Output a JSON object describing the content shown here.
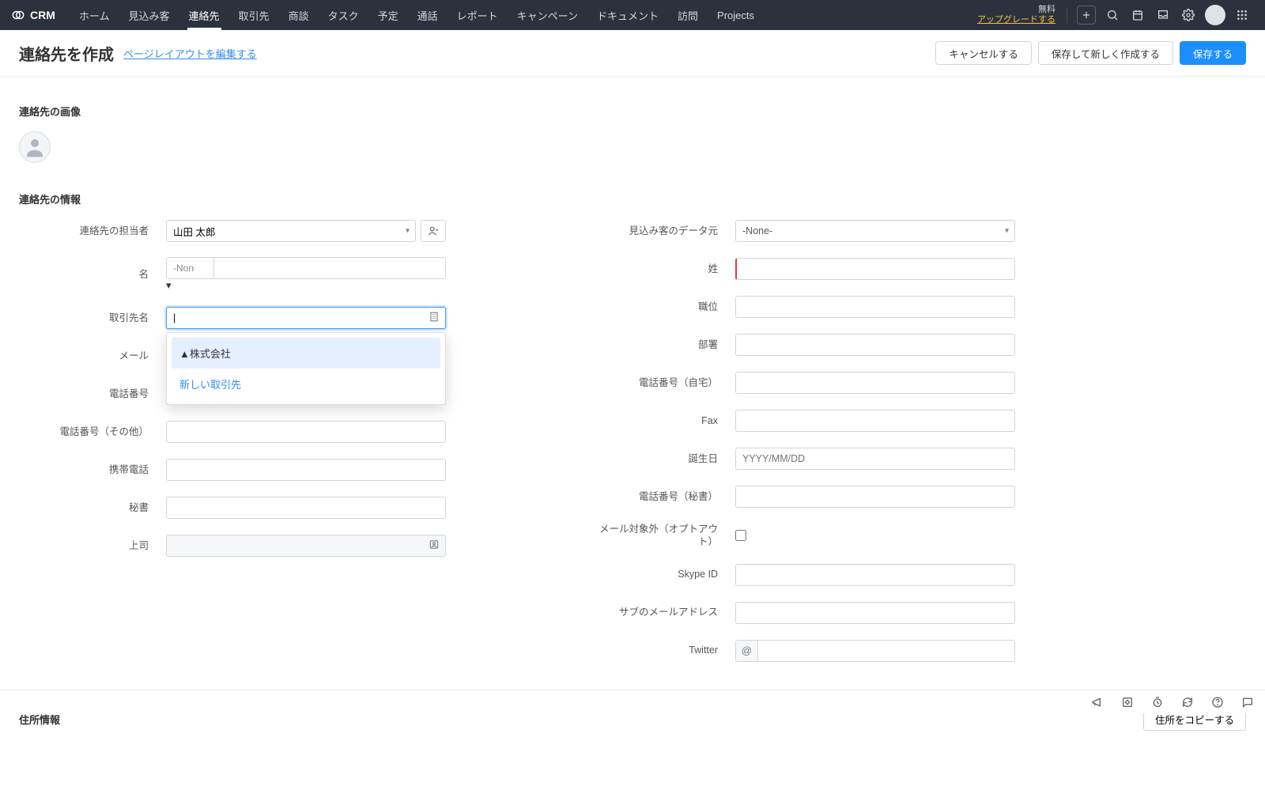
{
  "brand": "CRM",
  "nav": {
    "tabs": [
      "ホーム",
      "見込み客",
      "連絡先",
      "取引先",
      "商談",
      "タスク",
      "予定",
      "通話",
      "レポート",
      "キャンペーン",
      "ドキュメント",
      "訪問",
      "Projects"
    ],
    "active_index": 2,
    "upgrade_free": "無料",
    "upgrade_link": "アップグレードする"
  },
  "header": {
    "title": "連絡先を作成",
    "layout_link": "ページレイアウトを編集する",
    "buttons": {
      "cancel": "キャンセルする",
      "save_new": "保存して新しく作成する",
      "save": "保存する"
    }
  },
  "sections": {
    "image_title": "連絡先の画像",
    "info_title": "連絡先の情報",
    "address_title": "住所情報",
    "copy_address": "住所をコピーする"
  },
  "dropdown": {
    "option1": "▲株式会社",
    "new_account": "新しい取引先"
  },
  "fields": {
    "left": {
      "owner_label": "連絡先の担当者",
      "owner_value": "山田 太郎",
      "first_name_label": "名",
      "salutation_none": "-None-",
      "account_label": "取引先名",
      "email_label": "メール",
      "phone_label": "電話番号",
      "other_phone_label": "電話番号（その他）",
      "mobile_label": "携帯電話",
      "assistant_label": "秘書",
      "reports_to_label": "上司"
    },
    "right": {
      "lead_source_label": "見込み客のデータ元",
      "lead_source_value": "-None-",
      "last_name_label": "姓",
      "title_label": "職位",
      "department_label": "部署",
      "home_phone_label": "電話番号（自宅）",
      "fax_label": "Fax",
      "dob_label": "誕生日",
      "dob_placeholder": "YYYY/MM/DD",
      "asst_phone_label": "電話番号（秘書）",
      "opt_out_label": "メール対象外（オプトアウト）",
      "skype_label": "Skype ID",
      "secondary_email_label": "サブのメールアドレス",
      "twitter_label": "Twitter",
      "twitter_prefix": "@"
    }
  }
}
